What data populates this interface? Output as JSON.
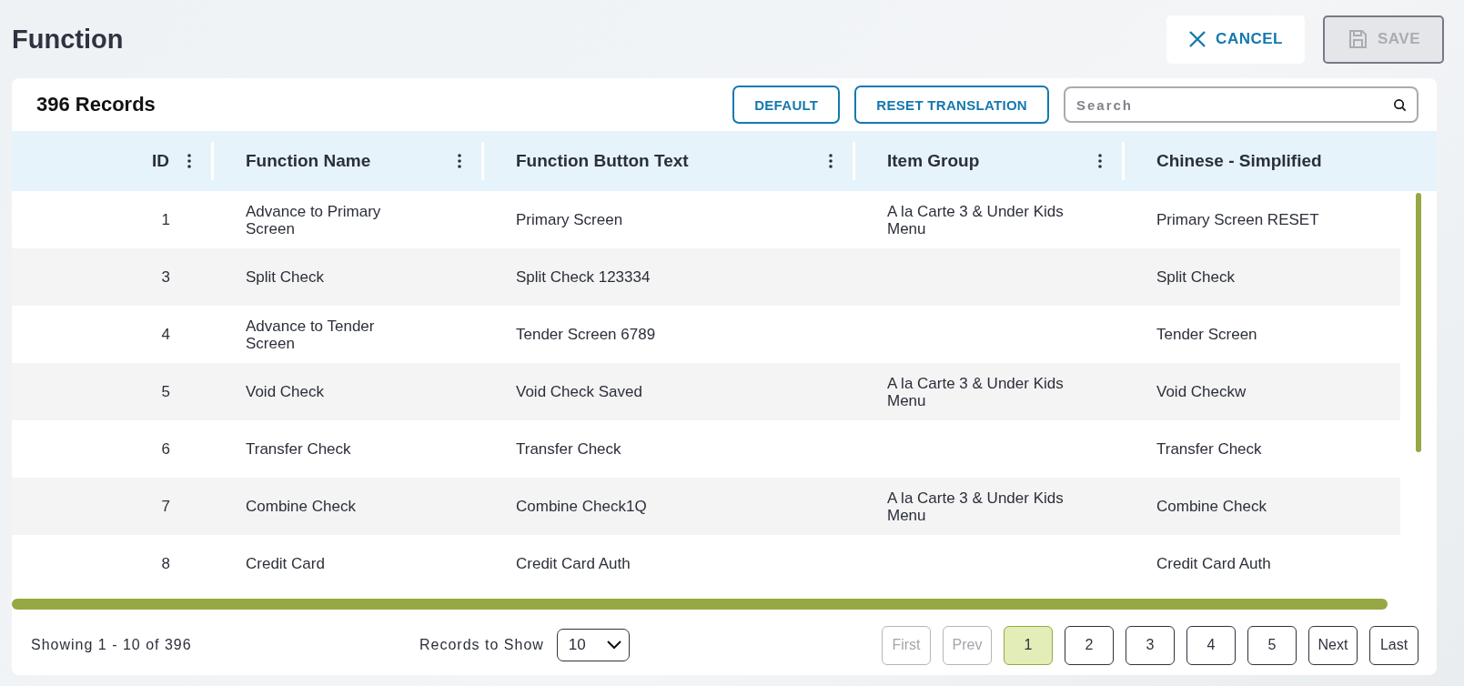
{
  "page": {
    "title": "Function"
  },
  "actions": [
    {
      "kind": "cancel",
      "label": "CANCEL",
      "disabled": false
    },
    {
      "kind": "save",
      "label": "SAVE",
      "disabled": true
    }
  ],
  "toolbar": {
    "count": "396 Records",
    "buttons": [
      "DEFAULT",
      "RESET TRANSLATION"
    ],
    "search": {
      "placeholder": "Search"
    }
  },
  "table": {
    "columns": [
      {
        "label": "ID",
        "menu": true
      },
      {
        "label": "Function Name",
        "menu": true
      },
      {
        "label": "Function Button Text",
        "menu": true
      },
      {
        "label": "Item Group",
        "menu": true
      },
      {
        "label": "Chinese - Simplified",
        "menu": false
      }
    ],
    "rows": [
      {
        "cells": [
          "1",
          "Advance to Primary Screen",
          "Primary Screen",
          "A la Carte 3 & Under Kids Menu",
          "Primary Screen RESET"
        ]
      },
      {
        "cells": [
          "3",
          "Split Check",
          "Split Check 123334",
          "",
          "Split Check"
        ]
      },
      {
        "cells": [
          "4",
          "Advance to Tender Screen",
          "Tender Screen 6789",
          "",
          "Tender Screen"
        ]
      },
      {
        "cells": [
          "5",
          "Void Check",
          "Void Check Saved",
          "A la Carte 3 & Under Kids Menu",
          "Void Checkw"
        ]
      },
      {
        "cells": [
          "6",
          "Transfer Check",
          "Transfer Check",
          "",
          "Transfer Check"
        ]
      },
      {
        "cells": [
          "7",
          "Combine Check",
          "Combine Check1Q",
          "A la Carte 3 & Under Kids Menu",
          "Combine Check"
        ]
      },
      {
        "cells": [
          "8",
          "Credit Card",
          "Credit Card Auth",
          "",
          "Credit Card Auth"
        ]
      }
    ]
  },
  "footer": {
    "showing": "Showing 1 - 10 of 396",
    "records_label": "Records to Show",
    "records_value": "10",
    "pages": [
      {
        "label": "First",
        "disabled": true,
        "selected": false
      },
      {
        "label": "Prev",
        "disabled": true,
        "selected": false
      },
      {
        "label": "1",
        "disabled": false,
        "selected": true
      },
      {
        "label": "2",
        "disabled": false,
        "selected": false
      },
      {
        "label": "3",
        "disabled": false,
        "selected": false
      },
      {
        "label": "4",
        "disabled": false,
        "selected": false
      },
      {
        "label": "5",
        "disabled": false,
        "selected": false
      },
      {
        "label": "Next",
        "disabled": false,
        "selected": false
      },
      {
        "label": "Last",
        "disabled": false,
        "selected": false
      }
    ]
  }
}
